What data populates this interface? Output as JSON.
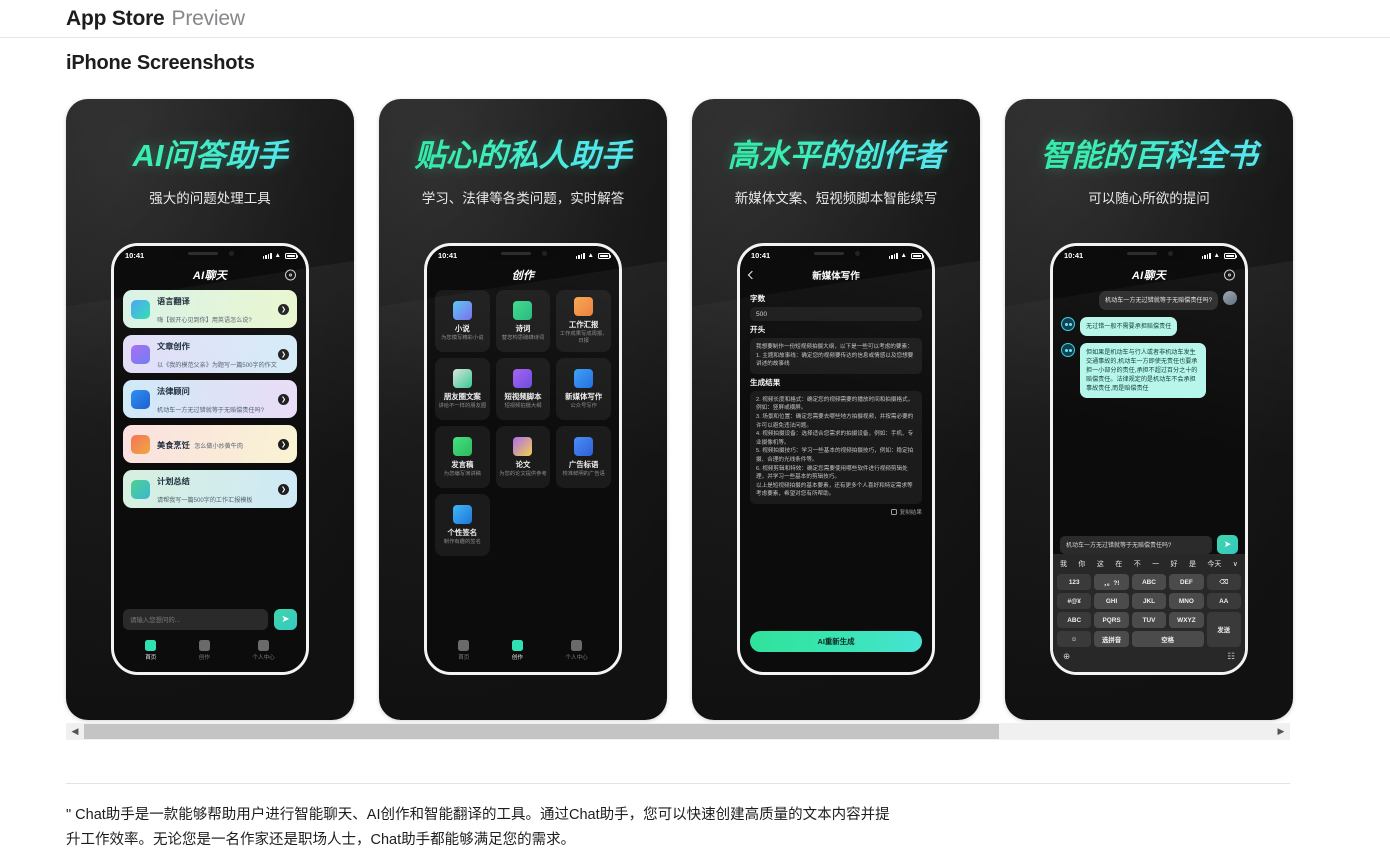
{
  "topbar": {
    "brand": "App Store",
    "preview": "Preview"
  },
  "section": {
    "title": "iPhone Screenshots"
  },
  "scrollbar": {
    "left_arrow": "◀",
    "right_arrow": "▶"
  },
  "description": "\" Chat助手是一款能够帮助用户进行智能聊天、AI创作和智能翻译的工具。通过Chat助手，您可以快速创建高质量的文本内容并提升工作效率。无论您是一名作家还是职场人士，Chat助手都能够满足您的需求。",
  "colors": {
    "accent_green": "#2ee6a0",
    "accent_cyan": "#4ee8e8",
    "card_bg": "#1a1a1a",
    "bot_bubble": "#b6f6ea"
  },
  "cards": [
    {
      "headline": "AI问答助手",
      "subline": "强大的问题处理工具",
      "status": {
        "time": "10:41"
      },
      "app_title": "AI聊天",
      "suggestions": [
        {
          "title": "语言翻译",
          "subtitle": "嗨【很开心见到你】用英语怎么说?",
          "grad": "linear-gradient(100deg,#d8f3e6,#e9f6cf)",
          "icon": "translate-icon",
          "iconbg": "linear-gradient(135deg,#4aa3f5,#2de0b0)"
        },
        {
          "title": "文章创作",
          "subtitle": "以《我的模范父亲》为题写一篇500字的作文",
          "grad": "linear-gradient(100deg,#e3ddf8,#d4ecf7)",
          "icon": "pencil-icon",
          "iconbg": "linear-gradient(135deg,#a86df0,#6f7bf5)"
        },
        {
          "title": "法律顾问",
          "subtitle": "机动车一方无过错就等于无赔偿责任吗?",
          "grad": "linear-gradient(100deg,#cfeaf8,#eadcf6)",
          "icon": "law-icon",
          "iconbg": "linear-gradient(135deg,#2f8ef0,#1d5fd0)"
        },
        {
          "title": "美食烹饪",
          "subtitle": "怎么做小炒黄牛肉",
          "grad": "linear-gradient(100deg,#fae0e0,#f9f3d3)",
          "icon": "food-icon",
          "iconbg": "linear-gradient(135deg,#f2735a,#f0a93f)"
        },
        {
          "title": "计划总结",
          "subtitle": "请帮我写一篇500字的工作汇报模板",
          "grad": "linear-gradient(100deg,#d6f0df,#cfe9f7)",
          "icon": "checklist-icon",
          "iconbg": "linear-gradient(135deg,#4fd08f,#3bb7d4)"
        }
      ],
      "composer": {
        "placeholder": "请输入您想问的...",
        "send_icon": "➤"
      },
      "tabs": [
        {
          "label": "首页",
          "icon": "home-icon",
          "active": true
        },
        {
          "label": "创作",
          "icon": "create-icon",
          "active": false
        },
        {
          "label": "个人中心",
          "icon": "profile-icon",
          "active": false
        }
      ]
    },
    {
      "headline": "贴心的私人助手",
      "subline": "学习、法律等各类问题，实时解答",
      "status": {
        "time": "10:41"
      },
      "app_title": "创作",
      "tools": [
        {
          "title": "小说",
          "subtitle": "为您模写精彩小说",
          "iconbg": "linear-gradient(135deg,#56c8f2,#7b6bf0)"
        },
        {
          "title": "诗词",
          "subtitle": "替您构思磅礴诗词",
          "iconbg": "linear-gradient(135deg,#3fd98f,#23b87a)"
        },
        {
          "title": "工作汇报",
          "subtitle": "工作成果写成周报、日报",
          "iconbg": "linear-gradient(135deg,#f5a84c,#ef7a3a)"
        },
        {
          "title": "朋友圈文案",
          "subtitle": "讲给不一样的朋友圈",
          "iconbg": "linear-gradient(135deg,#d8e5e0,#38c98f)"
        },
        {
          "title": "短视频脚本",
          "subtitle": "短视频拍摄大纲",
          "iconbg": "linear-gradient(135deg,#a663f0,#6d4ae0)"
        },
        {
          "title": "新媒体写作",
          "subtitle": "公众号写作",
          "iconbg": "linear-gradient(135deg,#3f9ef5,#1f6fe0)"
        },
        {
          "title": "发言稿",
          "subtitle": "为您编写演讲稿",
          "iconbg": "linear-gradient(135deg,#45e07f,#2cb95f)"
        },
        {
          "title": "论文",
          "subtitle": "为您的论文提供参考",
          "iconbg": "linear-gradient(135deg,#b06bf0,#f0d24a)"
        },
        {
          "title": "广告标语",
          "subtitle": "校准鲜明的广告语",
          "iconbg": "linear-gradient(135deg,#4a8ef5,#2f5fd8)"
        },
        {
          "title": "个性签名",
          "subtitle": "制作有趣的签名",
          "iconbg": "linear-gradient(135deg,#3fb8f5,#1f76d8)"
        }
      ],
      "tabs": [
        {
          "label": "首页",
          "icon": "home-icon",
          "active": false
        },
        {
          "label": "创作",
          "icon": "create-icon",
          "active": true
        },
        {
          "label": "个人中心",
          "icon": "profile-icon",
          "active": false
        }
      ]
    },
    {
      "headline": "高水平的创作者",
      "subline": "新媒体文案、短视频脚本智能续写",
      "status": {
        "time": "10:41"
      },
      "app_title": "新媒体写作",
      "form": {
        "count_label": "字数",
        "count_value": "500",
        "start_label": "开头",
        "start_value": "我想要制作一份短视频拍摄大纲，以下是一些可以考虑的要素：\n1. 主题和故事线：确定您的视频要传达的信息或情感以及您想要讲述的故事线",
        "result_label": "生成结果",
        "result_value": "2. 视频长度和格式：确定您的视频需要的播放时间和拍摄格式，例如：竖屏或横屏。\n3. 场景和位置：确定您需要去哪些地方拍摄视频，并按需必要的许可以避免违法问题。\n4. 视频拍摄设备：选择适合您需求的拍摄设备，例如：手机、专业摄像机等。\n5. 视频拍摄技巧：学习一些基本的视频拍摄技巧，例如：稳定拍摄、合理的光线条件等。\n6. 视频剪辑和特效：确定您需要使用哪些软件进行视频剪辑处理，并学习一些基本的剪辑技巧。\n以上是短视频拍摄的基本要素，还有更多个人喜好和特定需求等考虑要素，希望对您有所帮助。",
        "copy_label": "复制结果",
        "regen_label": "AI重新生成"
      }
    },
    {
      "headline": "智能的百科全书",
      "subline": "可以随心所欲的提问",
      "status": {
        "time": "10:41"
      },
      "app_title": "AI聊天",
      "messages": [
        {
          "from": "user",
          "text": "机动车一方无过错就等于无赔偿责任吗?"
        },
        {
          "from": "bot",
          "text": "无过错一般不需要承担赔偿责任"
        },
        {
          "from": "bot",
          "text": "但如果是机动车与行人或者非机动车发生交通事故的,机动车一方即使无责任也要承担一小部分的责任,承担不超过百分之十的赔偿责任。法律规定的是机动车不会承担事故责任,而是赔偿责任"
        }
      ],
      "composer": {
        "value": "机动车一方无过错就等于无赔偿责任吗?",
        "send_icon": "➤"
      },
      "keyboard": {
        "predictions": [
          "我",
          "你",
          "这",
          "在",
          "不",
          "一",
          "好",
          "是",
          "今天"
        ],
        "collapse_icon": "∨",
        "keys": [
          "123",
          "，。?!",
          "ABC",
          "DEF",
          "⌫",
          "#@¥",
          "GHI",
          "JKL",
          "MNO",
          "AA",
          "ABC",
          "PQRS",
          "TUV",
          "WXYZ",
          "发送",
          "☺",
          "选拼音",
          "空格"
        ],
        "globe_icon": "⊕",
        "mic_icon": "☷"
      }
    }
  ]
}
